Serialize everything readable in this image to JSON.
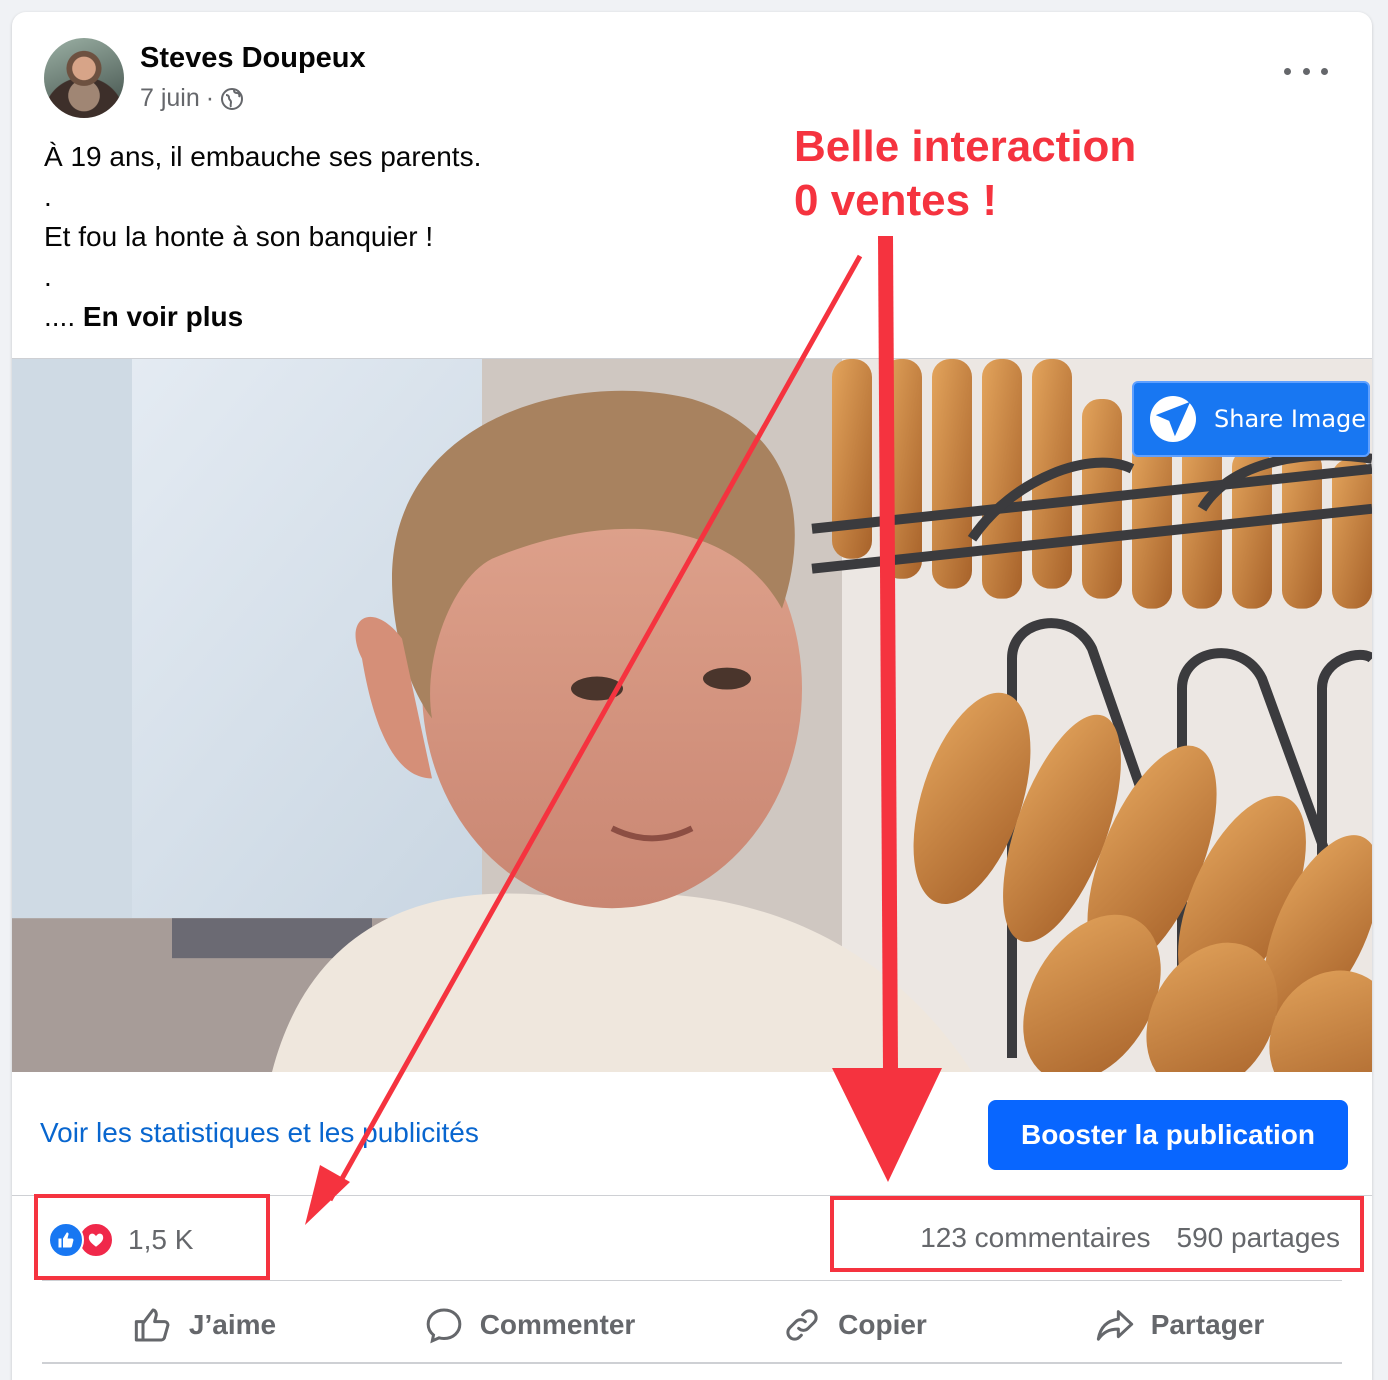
{
  "post": {
    "author": "Steves Doupeux",
    "date": "7 juin",
    "date_separator": "·",
    "text_lines": [
      "À 19 ans, il embauche ses parents.",
      ".",
      "Et fou la honte à son banquier !",
      "."
    ],
    "ellipsis": "....",
    "see_more": "En voir plus"
  },
  "image": {
    "share_button": "Share Image"
  },
  "insights": {
    "stats_link": "Voir les statistiques et les publicités",
    "boost_button": "Booster la publication"
  },
  "engagement": {
    "reaction_count": "1,5 K",
    "comments": "123 commentaires",
    "shares": "590 partages",
    "reaction_icons": [
      "like-icon",
      "love-icon"
    ]
  },
  "actions": [
    {
      "label": "J’aime",
      "icon": "thumbs-up-icon"
    },
    {
      "label": "Commenter",
      "icon": "comment-bubble-icon"
    },
    {
      "label": "Copier",
      "icon": "link-icon"
    },
    {
      "label": "Partager",
      "icon": "share-arrow-icon"
    }
  ],
  "annotation": {
    "line1": "Belle interaction",
    "line2": "0 ventes !",
    "color": "#f5333f"
  },
  "colors": {
    "brand_blue": "#0866ff",
    "link_blue": "#0866cf",
    "muted_text": "#65676b"
  }
}
